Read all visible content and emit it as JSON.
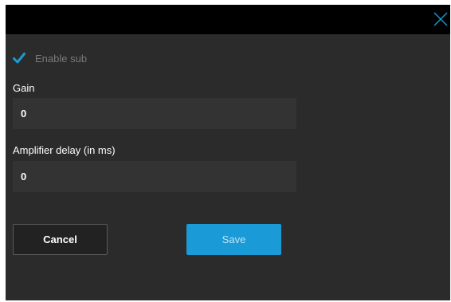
{
  "dialog": {
    "close_icon": "close-icon"
  },
  "enable_sub": {
    "label": "Enable sub",
    "checked": true,
    "icon": "checkmark-icon",
    "check_color": "#1a9ad6"
  },
  "gain": {
    "label": "Gain",
    "value": "0"
  },
  "amplifier_delay": {
    "label": "Amplifier delay (in ms)",
    "value": "0"
  },
  "buttons": {
    "cancel_label": "Cancel",
    "save_label": "Save"
  },
  "colors": {
    "accent": "#1a9ad6",
    "panel_bg": "#2b2b2b",
    "titlebar_bg": "#000000",
    "input_bg": "#333333"
  }
}
